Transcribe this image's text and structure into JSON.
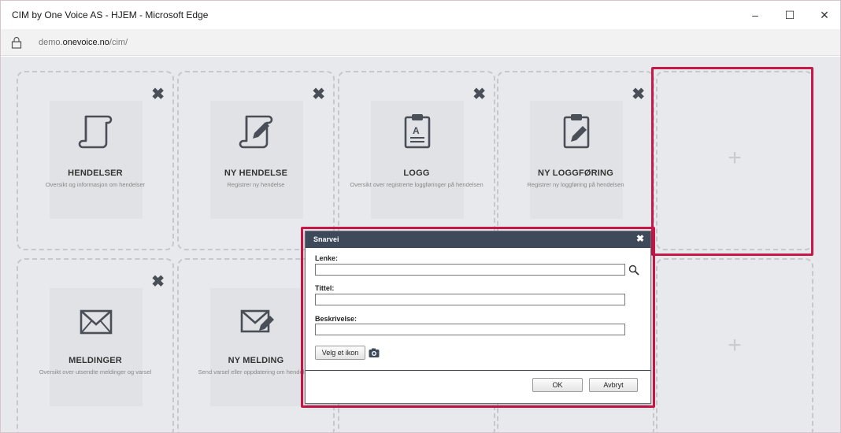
{
  "window": {
    "title": "CIM by One Voice AS - HJEM - Microsoft Edge",
    "minimize": "–",
    "maximize": "☐",
    "close": "✕"
  },
  "address": {
    "prefix": "demo.",
    "domain": "onevoice.no",
    "path": "/cim/"
  },
  "tiles": [
    {
      "name": "HENDELSER",
      "desc": "Oversikt og informasjon om hendelser",
      "icon": "scroll-icon"
    },
    {
      "name": "NY HENDELSE",
      "desc": "Registrer ny hendelse",
      "icon": "scroll-pencil-icon"
    },
    {
      "name": "LOGG",
      "desc": "Oversikt over registrerte loggføringer på hendelsen",
      "icon": "clipboard-icon"
    },
    {
      "name": "NY LOGGFØRING",
      "desc": "Registrer ny loggføring på hendelsen",
      "icon": "clipboard-pencil-icon"
    },
    {
      "name": "MELDINGER",
      "desc": "Oversikt over utsendte meldinger og varsel",
      "icon": "envelope-icon"
    },
    {
      "name": "NY MELDING",
      "desc": "Send varsel eller oppdatering om hendelsen",
      "icon": "envelope-pencil-icon"
    }
  ],
  "tile_remove": "✖",
  "add_symbol": "+",
  "dialog": {
    "title": "Snarvei",
    "close": "✖",
    "link_label": "Lenke:",
    "link_value": "",
    "title_label": "Tittel:",
    "title_value": "",
    "description_label": "Beskrivelse:",
    "description_value": "",
    "choose_icon_label": "Velg et ikon",
    "ok_label": "OK",
    "cancel_label": "Avbryt"
  },
  "colors": {
    "highlight": "#c8184a",
    "dialog_header": "#3e4a5a",
    "background": "#e8e9ec"
  }
}
